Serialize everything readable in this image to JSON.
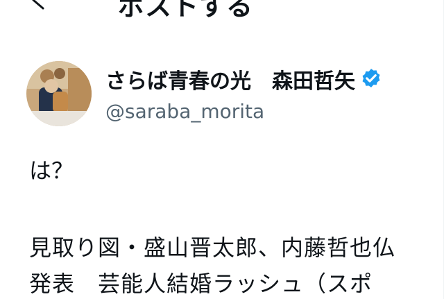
{
  "header": {
    "back_icon": "arrow-left-icon",
    "title": "ポストする"
  },
  "author": {
    "display_name": "さらば青春の光　森田哲矢",
    "handle": "@saraba_morita",
    "verified_icon": "verified-badge-icon",
    "verified_color": "#1d9bf0"
  },
  "post": {
    "lines": [
      "は？",
      "見取り図・盛山晋太郎、内藤哲也仏",
      "発表　芸能人結婚ラッシュ（スポ"
    ]
  },
  "colors": {
    "text": "#0f1419",
    "secondary_text": "#536471",
    "background": "#ffffff"
  }
}
